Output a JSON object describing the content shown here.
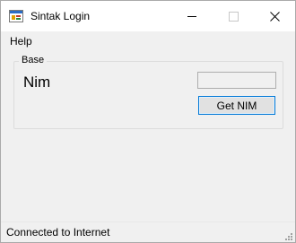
{
  "window": {
    "title": "Sintak Login",
    "app_icon": "windows-form-icon",
    "controls": {
      "minimize_icon": "minimize-icon",
      "maximize_icon": "maximize-icon",
      "close_icon": "close-icon",
      "close_glyph": "✕"
    }
  },
  "menu": {
    "items": [
      {
        "label": "Help"
      }
    ]
  },
  "group": {
    "legend": "Base",
    "nim_label": "Nim",
    "nim_value": "",
    "button_label": "Get NIM"
  },
  "status": {
    "text": "Connected to Internet"
  },
  "colors": {
    "focus_border": "#0078d7",
    "form_background": "#f0f0f0"
  }
}
